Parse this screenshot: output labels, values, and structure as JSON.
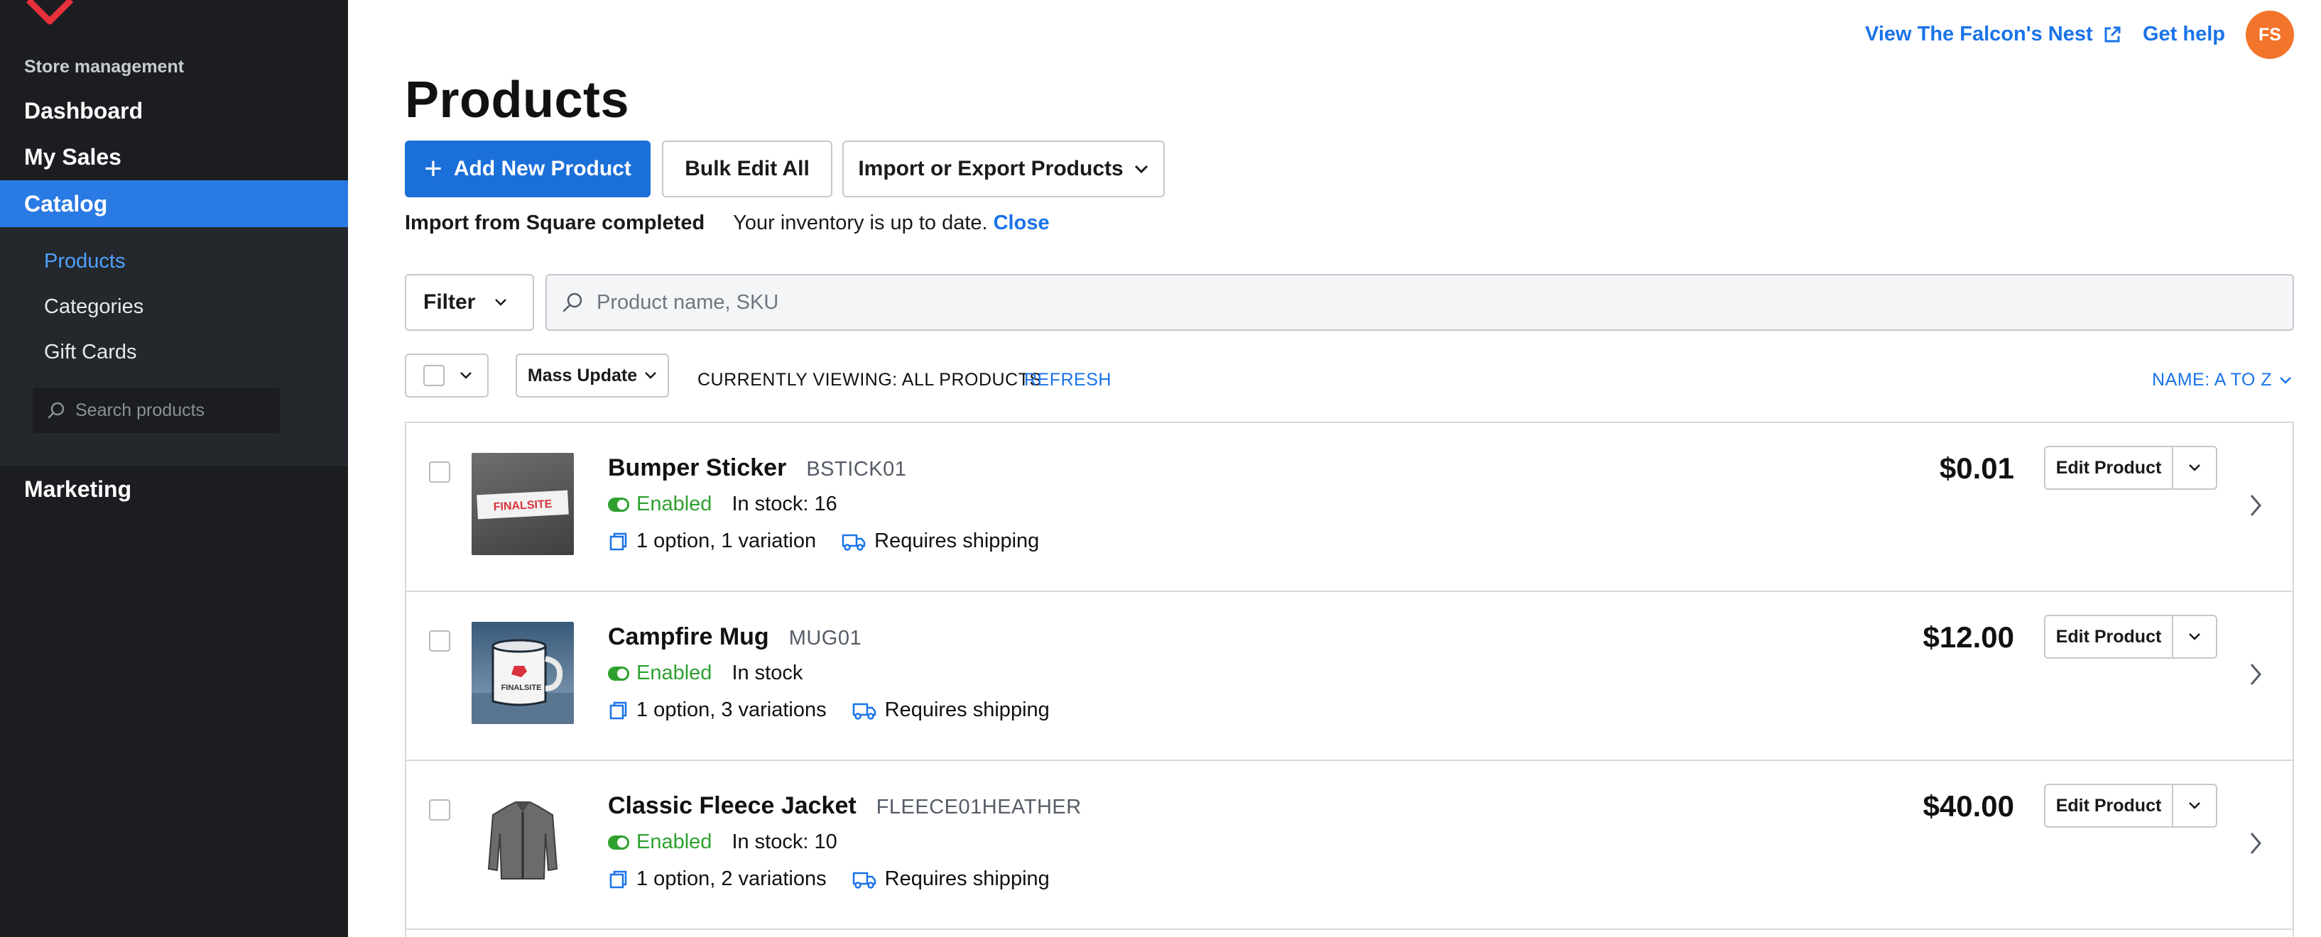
{
  "sidebar": {
    "section_label": "Store management",
    "items": [
      {
        "label": "Dashboard"
      },
      {
        "label": "My Sales"
      },
      {
        "label": "Catalog"
      },
      {
        "label": "Marketing"
      }
    ],
    "sub_items": [
      {
        "label": "Products"
      },
      {
        "label": "Categories"
      },
      {
        "label": "Gift Cards"
      }
    ],
    "search_placeholder": "Search products",
    "active_color": "#2a7ae4",
    "logo_color": "#e8313a"
  },
  "header": {
    "view_store": "View The Falcon's Nest",
    "get_help": "Get help",
    "avatar_initials": "FS",
    "avatar_color": "#f3742b"
  },
  "main": {
    "title": "Products",
    "add_button": "Add New Product",
    "bulk_button": "Bulk Edit All",
    "import_button": "Import or Export Products",
    "notice": {
      "heading": "Import from Square completed",
      "message": "Your inventory is up to date.",
      "close": "Close"
    },
    "filter_button": "Filter",
    "search_placeholder": "Product name, SKU",
    "mass_update": "Mass Update",
    "viewing": "CURRENTLY VIEWING: ALL PRODUCTS",
    "refresh": "REFRESH",
    "sort": "NAME: A TO Z",
    "edit_label": "Edit Product",
    "accent": "#1b6fd9",
    "enabled_color": "#2fa12f"
  },
  "products": [
    {
      "name": "Bumper Sticker",
      "sku": "BSTICK01",
      "status": "Enabled",
      "stock": "In stock: 16",
      "options": "1 option, 1 variation",
      "shipping": "Requires shipping",
      "price": "$0.01",
      "thumb_text": "FINALSITE",
      "thumb_icon": "bumper-sticker-image"
    },
    {
      "name": "Campfire Mug",
      "sku": "MUG01",
      "status": "Enabled",
      "stock": "In stock",
      "options": "1 option, 3 variations",
      "shipping": "Requires shipping",
      "price": "$12.00",
      "thumb_text": "FINALSITE",
      "thumb_icon": "campfire-mug-image"
    },
    {
      "name": "Classic Fleece Jacket",
      "sku": "FLEECE01HEATHER",
      "status": "Enabled",
      "stock": "In stock: 10",
      "options": "1 option, 2 variations",
      "shipping": "Requires shipping",
      "price": "$40.00",
      "thumb_icon": "fleece-jacket-image"
    }
  ]
}
